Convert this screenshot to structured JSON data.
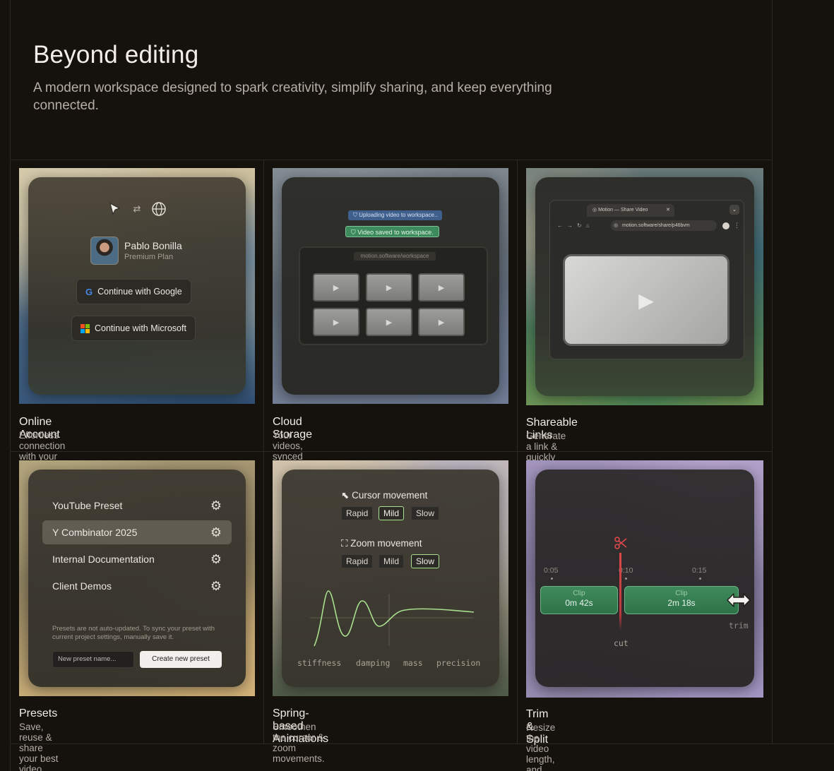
{
  "hero": {
    "title": "Beyond editing",
    "subtitle": "A modern workspace designed to spark creativity, simplify sharing, and keep everything connected."
  },
  "cards": [
    {
      "title": "Online Account",
      "subtitle": "Effortless connection with your email provider.",
      "icons": [
        "cursor-icon",
        "swap-icon",
        "globe-icon"
      ],
      "profile_name": "Pablo Bonilla",
      "profile_plan": "Premium Plan",
      "google_button": "Continue with Google",
      "microsoft_button": "Continue with Microsoft"
    },
    {
      "title": "Cloud Storage",
      "subtitle": "Your videos, synced and protected at all times.",
      "uploading_text": "Uploading video to workspace..",
      "saved_text": "Video saved to workspace.",
      "workspace_url": "motion.software/workspace"
    },
    {
      "title": "Shareable Links",
      "subtitle": "Generate a link & quickly share online.",
      "tab_title": "Motion — Share Video",
      "address": "motion.software/share/p46bvm"
    },
    {
      "title": "Presets",
      "subtitle": "Save, reuse & share your best video templates.",
      "presets": [
        "YouTube Preset",
        "Y Combinator 2025",
        "Internal Documentation",
        "Client Demos"
      ],
      "selected_index": 1,
      "note": "Presets are not auto-updated. To sync your preset with current project settings, manually save it.",
      "input_placeholder": "New preset name...",
      "create_button": "Create new preset"
    },
    {
      "title": "Spring-based Animations",
      "subtitle": "Smoothen the cursor & zoom movements.",
      "cursor_label": "Cursor movement",
      "zoom_label": "Zoom movement",
      "options": [
        "Rapid",
        "Mild",
        "Slow"
      ],
      "cursor_selected": "Mild",
      "zoom_selected": "Slow",
      "params": [
        "stiffness",
        "damping",
        "mass",
        "precision"
      ]
    },
    {
      "title": "Trim & Split",
      "subtitle": "Resize the video length, and cut clips.",
      "ticks": [
        "0:05",
        "0:10",
        "0:15"
      ],
      "clip_label": "Clip",
      "clip1_duration": "0m 42s",
      "clip2_duration": "2m 18s",
      "cut_label": "cut",
      "trim_label": "trim"
    }
  ],
  "colors": {
    "background": "#15120e",
    "accent_green": "#a9e08e",
    "clip_green": "#3f8a5a",
    "cut_red": "#e0484a"
  }
}
